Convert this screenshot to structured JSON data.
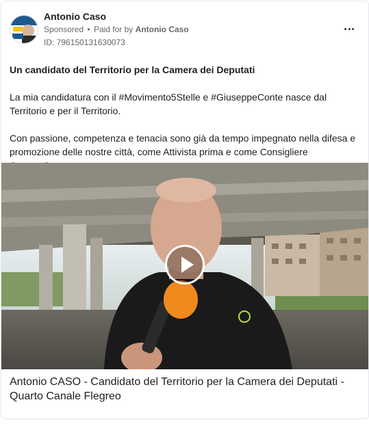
{
  "advertiser": {
    "name": "Antonio Caso",
    "sponsored_label": "Sponsored",
    "bullet": "•",
    "paid_for_prefix": "Paid for by",
    "paid_for_name": "Antonio Caso",
    "library_id": "ID: 796150131630073",
    "avatar_text": "CONTE",
    "avatar_text_top": "CASO"
  },
  "post": {
    "headline": "Un candidato del Territorio per la Camera dei Deputati",
    "paragraph_1": "La mia candidatura con il #Movimento5Stelle e #GiuseppeConte nasce dal Territorio e per il Territorio.",
    "paragraph_2": "Con passione, competenza e tenacia sono già da tempo impegnato nella difesa e promozione delle nostre città, come Attivista prima e come Consigliere Comunale..."
  },
  "media": {
    "type": "video",
    "play_icon": "play-icon"
  },
  "link_caption": "Antonio CASO - Candidato del Territorio per la Camera dei Deputati - Quarto Canale Flegreo",
  "icons": {
    "more": "more-options-icon"
  },
  "colors": {
    "text_primary": "#1c1e21",
    "text_secondary": "#65676b",
    "border": "#e4e6eb"
  }
}
